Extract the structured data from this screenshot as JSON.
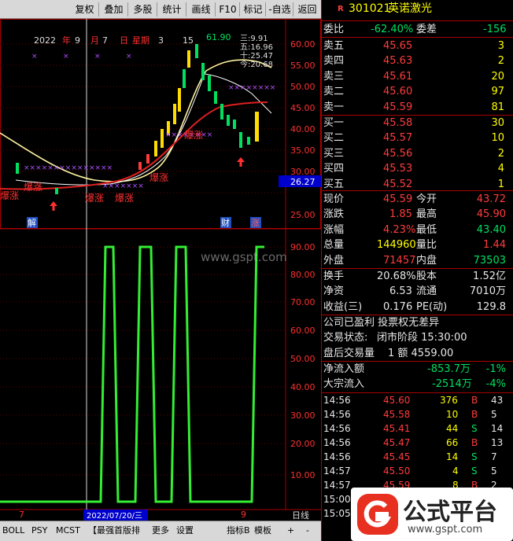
{
  "toolbar": {
    "items": [
      "复权",
      "叠加",
      "多股",
      "统计",
      "画线",
      "F10",
      "标记",
      "-自选",
      "返回"
    ]
  },
  "chart_info": {
    "date_line": [
      "2022",
      "年",
      "9",
      "月",
      "7",
      "日",
      "星期",
      "3"
    ],
    "ma_labels": [
      "三:9.91",
      "五:16.96",
      "十:25.47",
      "今:20.68"
    ],
    "high_label": "61.90",
    "left_mark": "15",
    "price_axis": [
      "60.00",
      "55.00",
      "50.00",
      "45.00",
      "40.00",
      "35.00",
      "30.00",
      "25.00"
    ],
    "current_price_tag": "26.27",
    "k_markers": [
      "解",
      "财",
      "涨"
    ],
    "signals": [
      "爆涨",
      "爆涨",
      "爆涨",
      "爆涨",
      "爆涨",
      "爆涨"
    ]
  },
  "indicator_axis": [
    "90.00",
    "80.00",
    "70.00",
    "60.00",
    "50.00",
    "40.00",
    "30.00",
    "20.00",
    "10.00"
  ],
  "x_axis": {
    "left_mark": "7",
    "date_box": "2022/07/20/三",
    "right_mark": "9",
    "day_label": "日线"
  },
  "tabs": [
    "BOLL",
    "PSY",
    "MCST",
    "【最强首版排",
    "更多",
    "设置",
    "指标B",
    "模板",
    "+",
    "-"
  ],
  "watermark": "www.gspt.com",
  "stock": {
    "icon": "R",
    "code": "301021",
    "name": "英诺激光"
  },
  "order_stats": {
    "weibi_label": "委比",
    "weibi_value": "-62.40%",
    "weicha_label": "委差",
    "weicha_value": "-156"
  },
  "asks": [
    {
      "label": "卖五",
      "price": "45.65",
      "vol": "3"
    },
    {
      "label": "卖四",
      "price": "45.63",
      "vol": "2"
    },
    {
      "label": "卖三",
      "price": "45.61",
      "vol": "20"
    },
    {
      "label": "卖二",
      "price": "45.60",
      "vol": "97"
    },
    {
      "label": "卖一",
      "price": "45.59",
      "vol": "81"
    }
  ],
  "bids": [
    {
      "label": "买一",
      "price": "45.58",
      "vol": "30"
    },
    {
      "label": "买二",
      "price": "45.57",
      "vol": "10"
    },
    {
      "label": "买三",
      "price": "45.56",
      "vol": "2"
    },
    {
      "label": "买四",
      "price": "45.53",
      "vol": "4"
    },
    {
      "label": "买五",
      "price": "45.52",
      "vol": "1"
    }
  ],
  "quote": [
    {
      "l1": "现价",
      "v1": "45.59",
      "l2": "今开",
      "v2": "43.72",
      "c1": "red",
      "c2": "red"
    },
    {
      "l1": "涨跌",
      "v1": "1.85",
      "l2": "最高",
      "v2": "45.90",
      "c1": "red",
      "c2": "red"
    },
    {
      "l1": "涨幅",
      "v1": "4.23%",
      "l2": "最低",
      "v2": "43.40",
      "c1": "red",
      "c2": "grn"
    },
    {
      "l1": "总量",
      "v1": "144960",
      "l2": "量比",
      "v2": "1.44",
      "c1": "yel",
      "c2": "red"
    },
    {
      "l1": "外盘",
      "v1": "71457",
      "l2": "内盘",
      "v2": "73503",
      "c1": "red",
      "c2": "grn"
    }
  ],
  "fundamentals": [
    {
      "l1": "换手",
      "v1": "20.68%",
      "l2": "股本",
      "v2": "1.52亿"
    },
    {
      "l1": "净资",
      "v1": "6.53",
      "l2": "流通",
      "v2": "7010万"
    },
    {
      "l1": "收益(三)",
      "v1": "0.176",
      "l2": "PE(动)",
      "v2": "129.8"
    }
  ],
  "notes": {
    "profit": "公司已盈利 投票权无差异",
    "status_label": "交易状态:",
    "status_value": "闭市阶段 15:30:00",
    "after_label": "盘后交易量",
    "after_value": "1 额 4559.00"
  },
  "flows": [
    {
      "label": "净流入额",
      "value": "-853.7万",
      "pct": "-1%"
    },
    {
      "label": "大宗流入",
      "value": "-2514万",
      "pct": "-4%"
    }
  ],
  "ticks": [
    {
      "time": "14:56",
      "price": "45.60",
      "vol": "376",
      "side": "B",
      "n": "43",
      "pc": "red",
      "sc": "red"
    },
    {
      "time": "14:56",
      "price": "45.58",
      "vol": "10",
      "side": "B",
      "n": "5",
      "pc": "red",
      "sc": "red"
    },
    {
      "time": "14:56",
      "price": "45.41",
      "vol": "44",
      "side": "S",
      "n": "14",
      "pc": "red",
      "sc": "grn"
    },
    {
      "time": "14:56",
      "price": "45.47",
      "vol": "66",
      "side": "B",
      "n": "13",
      "pc": "red",
      "sc": "red"
    },
    {
      "time": "14:56",
      "price": "45.45",
      "vol": "14",
      "side": "S",
      "n": "7",
      "pc": "red",
      "sc": "grn"
    },
    {
      "time": "14:57",
      "price": "45.50",
      "vol": "4",
      "side": "S",
      "n": "5",
      "pc": "red",
      "sc": "grn"
    },
    {
      "time": "14:57",
      "price": "45.59",
      "vol": "8",
      "side": "B",
      "n": "2",
      "pc": "red",
      "sc": "red"
    },
    {
      "time": "15:00",
      "price": "",
      "vol": "",
      "side": "",
      "n": "",
      "pc": "red",
      "sc": "red"
    },
    {
      "time": "15:05",
      "price": "",
      "vol": "",
      "side": "",
      "n": "",
      "pc": "red",
      "sc": "red"
    }
  ],
  "logo": {
    "text": "公式平台",
    "url": "www.gspt.com"
  },
  "colors": {
    "up": "#ff3c3c",
    "down": "#00e060",
    "indicator": "#33ee33",
    "panel_border": "#aa0000"
  }
}
